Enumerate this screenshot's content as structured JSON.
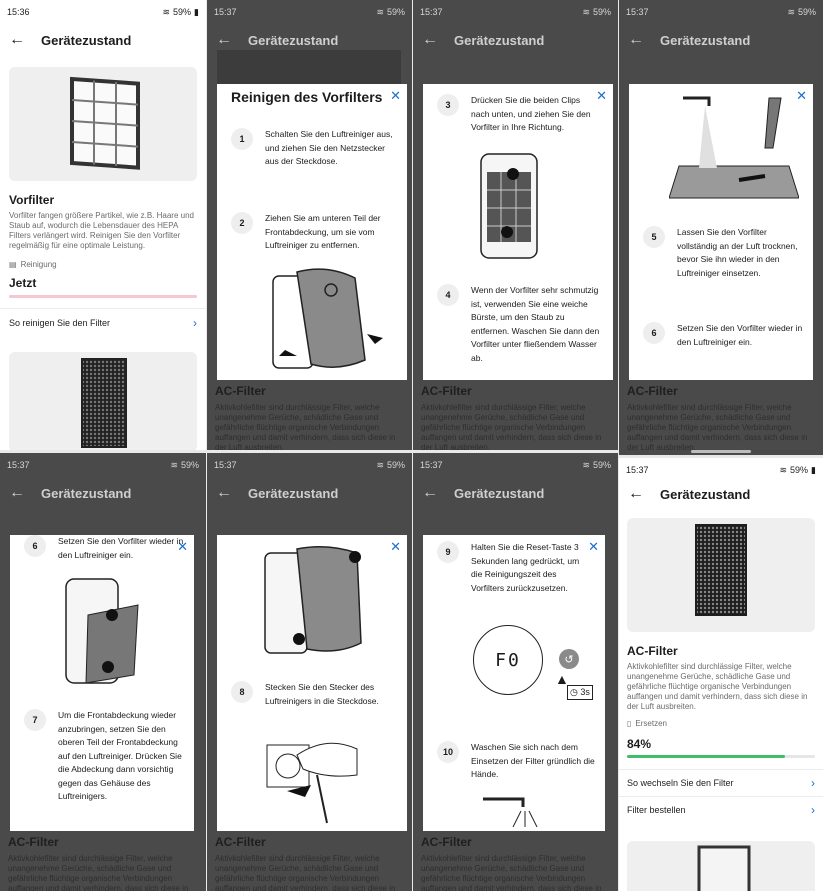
{
  "colors": {
    "accent": "#1b6fd1",
    "progress_pink": "#f4c7d1",
    "progress_green": "#3fbf6b",
    "dim_bg": "#4a4a4a"
  },
  "screens": {
    "s1": {
      "status": {
        "time": "15:36",
        "battery": "59%"
      },
      "appbar_title": "Gerätezustand",
      "filter_title": "Vorfilter",
      "filter_desc": "Vorfilter fangen größere Partikel, wie z.B. Haare und Staub auf, wodurch die Lebensdauer des HEPA Filters verlängert wird. Reinigen Sie den Vorfilter regelmäßig für eine optimale Leistung.",
      "status_label": "Reinigung",
      "status_value": "Jetzt",
      "progress": 1.0,
      "link": "So reinigen Sie den Filter"
    },
    "s2": {
      "status": {
        "time": "15:37",
        "battery": "59%"
      },
      "appbar_title": "Gerätezustand",
      "modal_title": "Reinigen des Vorfilters",
      "steps": [
        {
          "num": "1",
          "text": "Schalten Sie den Luftreiniger aus, und ziehen Sie den Netzstecker aus der Steckdose."
        },
        {
          "num": "2",
          "text": "Ziehen Sie am unteren Teil der Frontabdeckung, um sie vom Luftreiniger zu entfernen."
        }
      ],
      "bg_title": "AC-Filter",
      "bg_desc": "Aktivkohlefilter sind durchlässige Filter, welche unangenehme Gerüche, schädliche Gase und gefährliche flüchtige organische Verbindungen auffangen und damit verhindern, dass sich diese in der Luft ausbreiten."
    },
    "s3": {
      "status": {
        "time": "15:37",
        "battery": "59%"
      },
      "appbar_title": "Gerätezustand",
      "steps": [
        {
          "num": "3",
          "text": "Drücken Sie die beiden Clips nach unten, und ziehen Sie den Vorfilter in Ihre Richtung."
        },
        {
          "num": "4",
          "text": "Wenn der Vorfilter sehr schmutzig ist, verwenden Sie eine weiche Bürste, um den Staub zu entfernen. Waschen Sie dann den Vorfilter unter fließendem Wasser ab."
        }
      ],
      "bg_title": "AC-Filter",
      "bg_desc": "Aktivkohlefilter sind durchlässige Filter, welche unangenehme Gerüche, schädliche Gase und gefährliche flüchtige organische Verbindungen auffangen und damit verhindern, dass sich diese in der Luft ausbreiten."
    },
    "s4": {
      "status": {
        "time": "15:37",
        "battery": "59%"
      },
      "appbar_title": "Gerätezustand",
      "steps": [
        {
          "num": "5",
          "text": "Lassen Sie den Vorfilter vollständig an der Luft trocknen, bevor Sie ihn wieder in den Luftreiniger einsetzen."
        },
        {
          "num": "6",
          "text": "Setzen Sie den Vorfilter wieder in den Luftreiniger ein."
        }
      ],
      "bg_title": "AC-Filter",
      "bg_desc": "Aktivkohlefilter sind durchlässige Filter, welche unangenehme Gerüche, schädliche Gase und gefährliche flüchtige organische Verbindungen auffangen und damit verhindern, dass sich diese in der Luft ausbreiten."
    },
    "s5": {
      "status": {
        "time": "15:37",
        "battery": "59%"
      },
      "appbar_title": "Gerätezustand",
      "steps": [
        {
          "num": "6",
          "text": "Setzen Sie den Vorfilter wieder in den Luftreiniger ein."
        },
        {
          "num": "7",
          "text": "Um die Frontabdeckung wieder anzubringen, setzen Sie den oberen Teil der Frontabdeckung auf den Luftreiniger. Drücken Sie die Abdeckung dann vorsichtig gegen das Gehäuse des Luftreinigers."
        }
      ],
      "bg_title": "AC-Filter",
      "bg_desc": "Aktivkohlefilter sind durchlässige Filter, welche unangenehme Gerüche, schädliche Gase und gefährliche flüchtige organische Verbindungen auffangen und damit verhindern, dass sich diese in der Luft ausbreiten."
    },
    "s6": {
      "status": {
        "time": "15:37",
        "battery": "59%"
      },
      "appbar_title": "Gerätezustand",
      "steps": [
        {
          "num": "8",
          "text": "Stecken Sie den Stecker des Luftreinigers in die Steckdose."
        }
      ],
      "bg_title": "AC-Filter",
      "bg_desc": "Aktivkohlefilter sind durchlässige Filter, welche unangenehme Gerüche, schädliche Gase und gefährliche flüchtige organische Verbindungen auffangen und damit verhindern, dass sich diese in der Luft ausbreiten."
    },
    "s7": {
      "status": {
        "time": "15:37",
        "battery": "59%"
      },
      "appbar_title": "Gerätezustand",
      "steps": [
        {
          "num": "9",
          "text": "Halten Sie die Reset-Taste 3 Sekunden lang gedrückt, um die Reinigungszeit des Vorfilters zurückzusetzen."
        },
        {
          "num": "10",
          "text": "Waschen Sie sich nach dem Einsetzen der Filter gründlich die Hände."
        }
      ],
      "display_code": "F0",
      "hold_time": "3s",
      "bg_title": "AC-Filter",
      "bg_desc": "Aktivkohlefilter sind durchlässige Filter, welche unangenehme Gerüche, schädliche Gase und gefährliche flüchtige organische Verbindungen auffangen und damit verhindern, dass sich diese in der Luft ausbreiten."
    },
    "s8": {
      "status": {
        "time": "15:37",
        "battery": "59%"
      },
      "appbar_title": "Gerätezustand",
      "filter_title": "AC-Filter",
      "filter_desc": "Aktivkohlefilter sind durchlässige Filter, welche unangenehme Gerüche, schädliche Gase und gefährliche flüchtige organische Verbindungen auffangen und damit verhindern, dass sich diese in der Luft ausbreiten.",
      "status_label": "Ersetzen",
      "status_value": "84%",
      "progress": 0.84,
      "links": [
        "So wechseln Sie den Filter",
        "Filter bestellen"
      ]
    }
  }
}
